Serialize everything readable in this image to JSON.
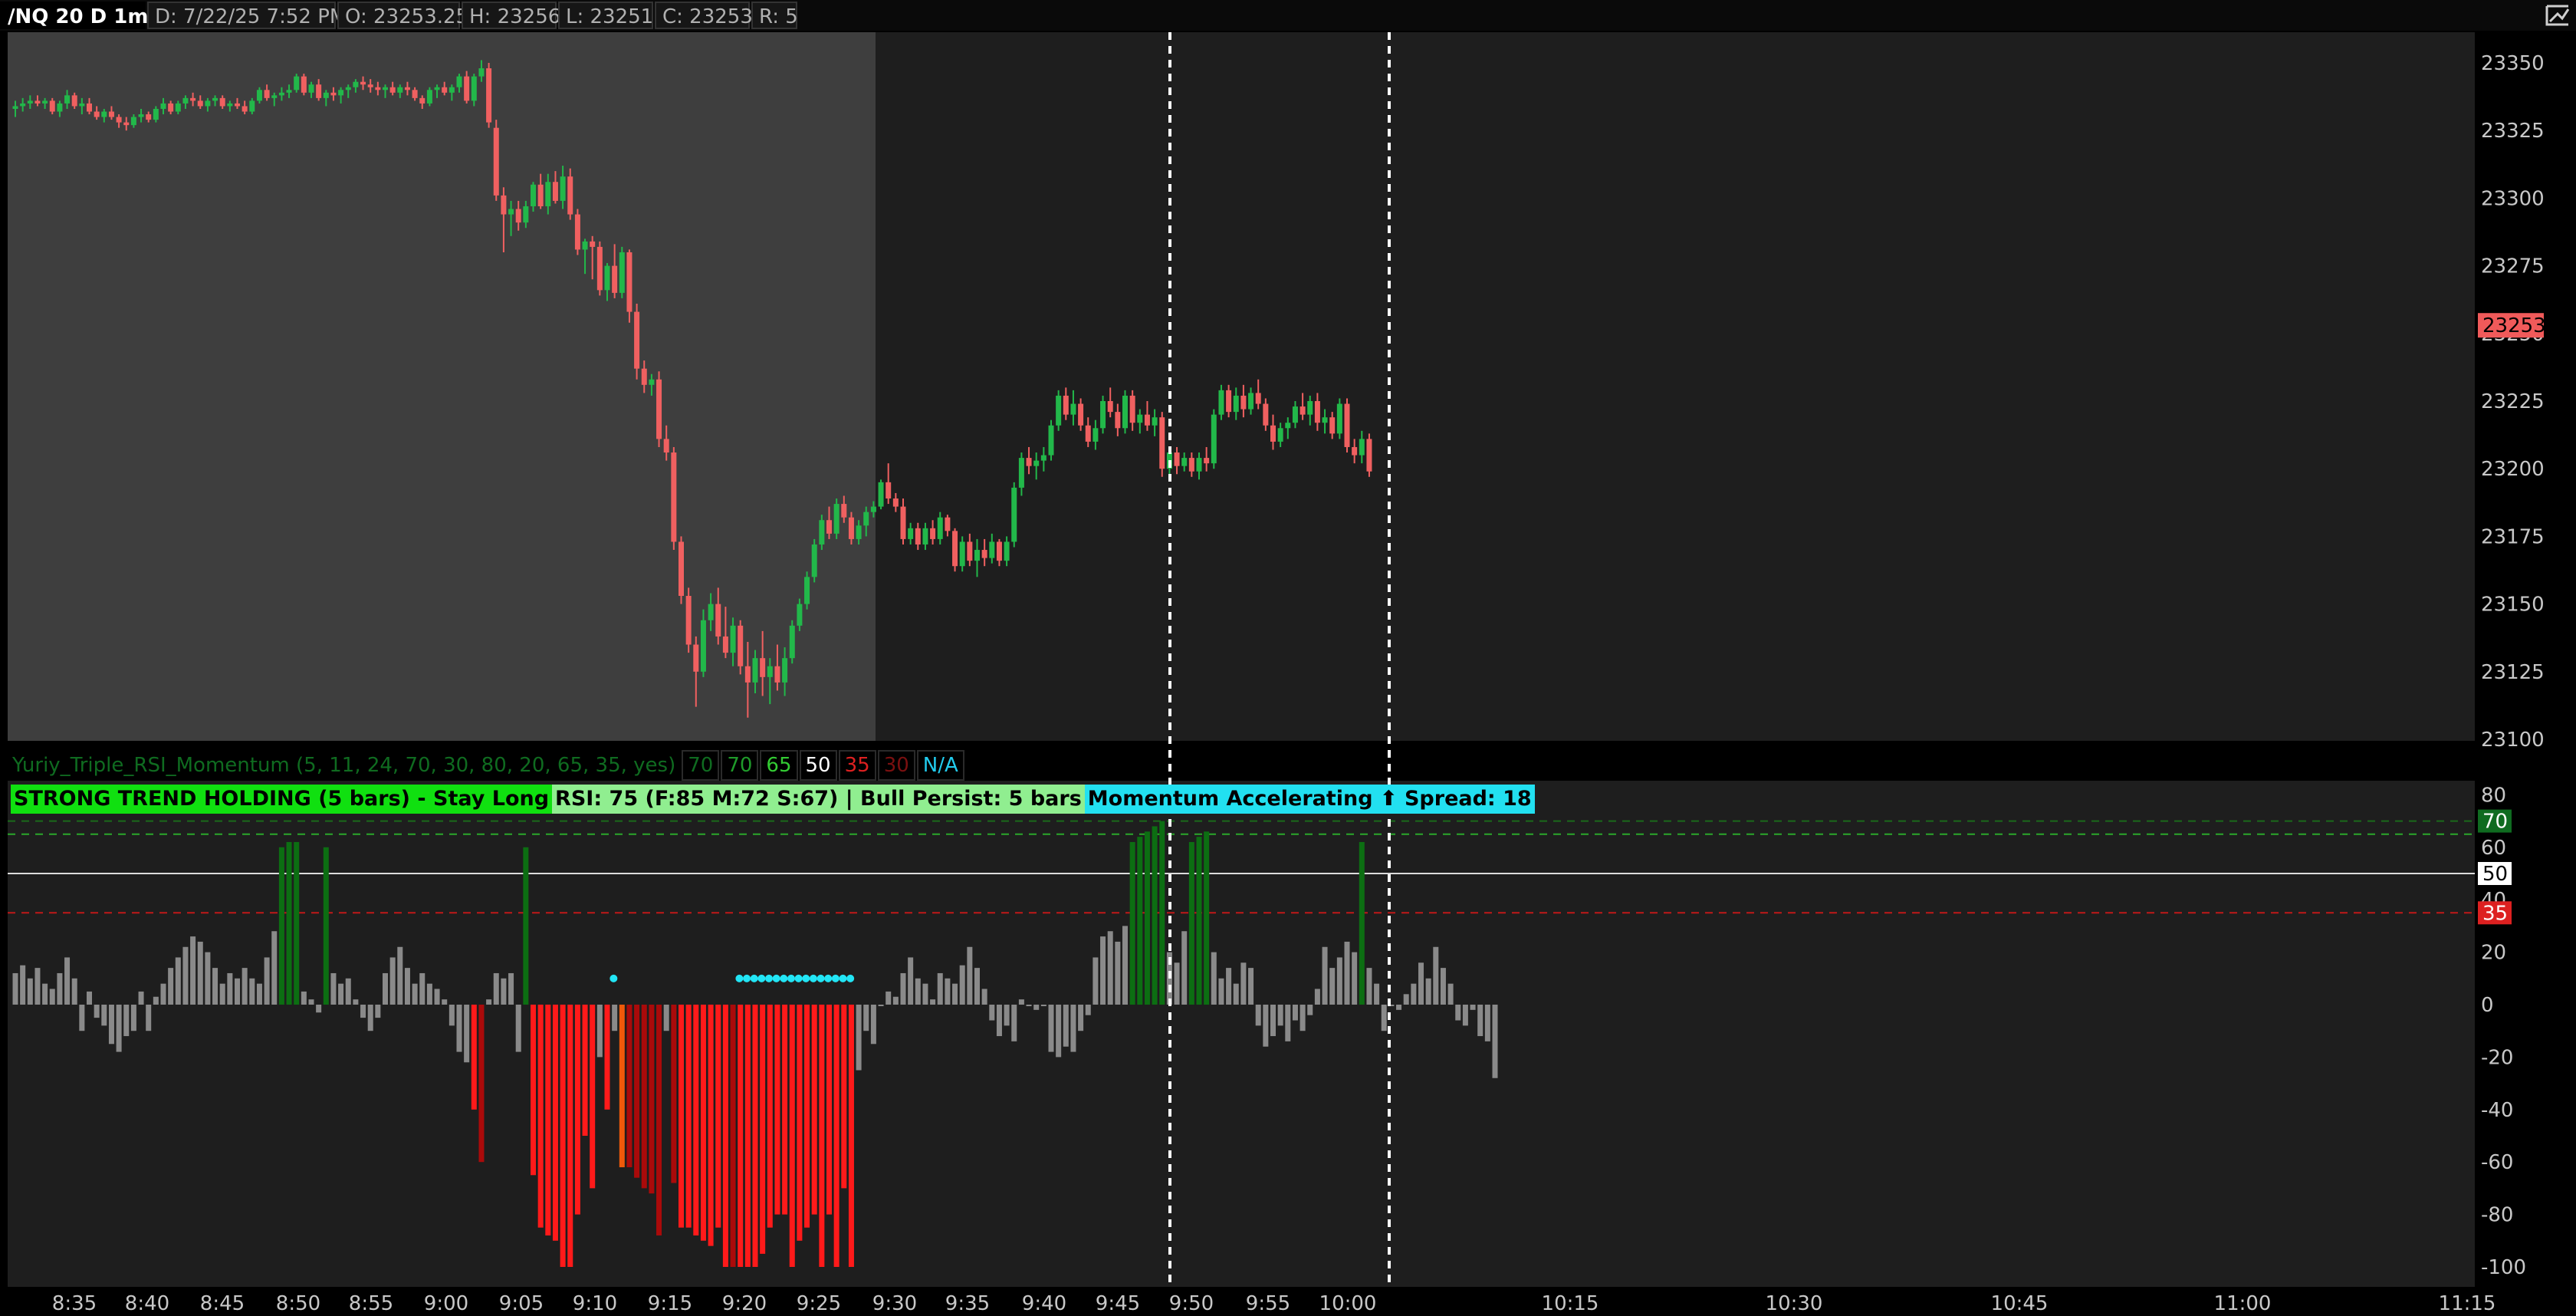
{
  "header": {
    "symbol": "/NQ 20 D 1m",
    "date": "D: 7/22/25 7:52 PM",
    "open": "O: 23253.25",
    "high": "H: 23256",
    "low": "L: 23251",
    "close": "C: 23253",
    "range": "R: 5"
  },
  "corner_icon": "chart-settings-icon",
  "price_axis": {
    "ticks": [
      "23350",
      "23325",
      "23300",
      "23275",
      "23250",
      "23225",
      "23200",
      "23175",
      "23150",
      "23125",
      "23100"
    ],
    "current_price": "23253",
    "current_price_color": "#f05a5a"
  },
  "study": {
    "name": "Yuriy_Triple_RSI_Momentum (5, 11, 24, 70, 30, 80, 20, 65, 35, yes)",
    "values": [
      {
        "text": "70",
        "color": "#0f6b20"
      },
      {
        "text": "70",
        "color": "#1f9a2a"
      },
      {
        "text": "65",
        "color": "#33cc33"
      },
      {
        "text": "50",
        "color": "#ffffff"
      },
      {
        "text": "35",
        "color": "#dd2020"
      },
      {
        "text": "30",
        "color": "#7a1010"
      },
      {
        "text": "N/A",
        "color": "#22ccee"
      }
    ],
    "labels": [
      "STRONG TREND HOLDING (5 bars) - Stay Long",
      "RSI: 75 (F:85 M:72 S:67) | Bull Persist: 5 bars",
      "Momentum Accelerating ⬆ Spread: 18"
    ]
  },
  "indicator_axis": {
    "ticks": [
      "80",
      "60",
      "40",
      "20",
      "0",
      "-20",
      "-40",
      "-60",
      "-80",
      "-100"
    ],
    "markers": [
      {
        "text": "70",
        "color": "#0f6b20"
      },
      {
        "text": "50",
        "color": "#ffffff"
      },
      {
        "text": "35",
        "color": "#dd2020"
      }
    ]
  },
  "time_axis": {
    "labels": [
      "8:35",
      "8:40",
      "8:45",
      "8:50",
      "8:55",
      "9:00",
      "9:05",
      "9:10",
      "9:15",
      "9:20",
      "9:25",
      "9:30",
      "9:35",
      "9:40",
      "9:45",
      "9:50",
      "9:55",
      "10:00",
      "10:15",
      "10:30",
      "10:45",
      "11:00",
      "11:15"
    ]
  },
  "colors": {
    "up_candle": "#22b84a",
    "down_candle": "#f06060",
    "bull_strong_bar": "#0c6e12",
    "neutral_bar": "#8a8a8a",
    "bear_bar": "#ff1a1a",
    "bear_dark_bar": "#aa0a0a",
    "bear_orange_bar": "#f05a0a",
    "accel_dot": "#22e5f5",
    "session_divider": "#ffffff"
  }
}
